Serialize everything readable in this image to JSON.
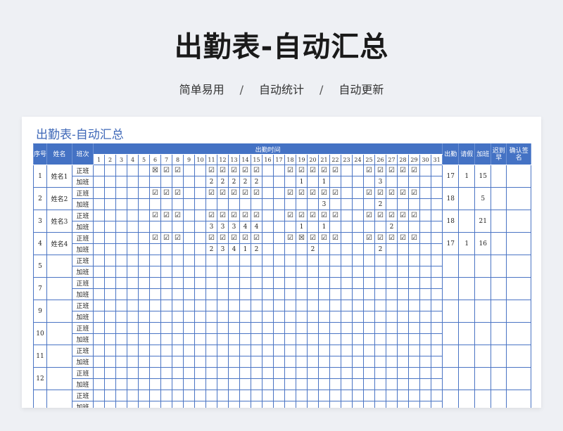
{
  "header": {
    "title": "出勤表-自动汇总",
    "tags": [
      "简单易用",
      "自动统计",
      "自动更新"
    ],
    "separator": "/"
  },
  "sheet": {
    "title": "出勤表-自动汇总",
    "columns": {
      "index": "序号",
      "name": "姓名",
      "shift": "班次",
      "attendance_time": "出勤时间",
      "attend": "出勤",
      "leave": "请假",
      "overtime": "加班",
      "late": "迟到早",
      "sign": "确认签名"
    },
    "days": [
      "1",
      "2",
      "3",
      "4",
      "5",
      "6",
      "7",
      "8",
      "9",
      "10",
      "11",
      "12",
      "13",
      "14",
      "15",
      "16",
      "17",
      "18",
      "19",
      "20",
      "21",
      "22",
      "23",
      "24",
      "25",
      "26",
      "27",
      "28",
      "29",
      "30",
      "31"
    ],
    "symbols": {
      "ok": "☑",
      "absent": "☒"
    },
    "rows": [
      {
        "index": "1",
        "name": "姓名1",
        "regular_label": "正班",
        "overtime_label": "加班",
        "regular": {
          "6": "absent",
          "7": "ok",
          "8": "ok",
          "11": "ok",
          "12": "ok",
          "13": "ok",
          "14": "ok",
          "15": "ok",
          "18": "ok",
          "19": "ok",
          "20": "ok",
          "21": "ok",
          "22": "ok",
          "25": "ok",
          "26": "ok",
          "27": "ok",
          "28": "ok",
          "29": "ok"
        },
        "overtime": {
          "11": "2",
          "12": "2",
          "13": "2",
          "14": "2",
          "15": "2",
          "19": "1",
          "21": "1",
          "26": "3"
        },
        "attend": "17",
        "leave": "1",
        "overtime_total": "15",
        "late": ""
      },
      {
        "index": "2",
        "name": "姓名2",
        "regular_label": "正班",
        "overtime_label": "加班",
        "regular": {
          "6": "ok",
          "7": "ok",
          "8": "ok",
          "11": "ok",
          "12": "ok",
          "13": "ok",
          "14": "ok",
          "15": "ok",
          "18": "ok",
          "19": "ok",
          "20": "ok",
          "21": "ok",
          "22": "ok",
          "25": "ok",
          "26": "ok",
          "27": "ok",
          "28": "ok",
          "29": "ok"
        },
        "overtime": {
          "21": "3",
          "26": "2"
        },
        "attend": "18",
        "leave": "",
        "overtime_total": "5",
        "late": ""
      },
      {
        "index": "3",
        "name": "姓名3",
        "regular_label": "正班",
        "overtime_label": "加班",
        "regular": {
          "6": "ok",
          "7": "ok",
          "8": "ok",
          "11": "ok",
          "12": "ok",
          "13": "ok",
          "14": "ok",
          "15": "ok",
          "18": "ok",
          "19": "ok",
          "20": "ok",
          "21": "ok",
          "22": "ok",
          "25": "ok",
          "26": "ok",
          "27": "ok",
          "28": "ok",
          "29": "ok"
        },
        "overtime": {
          "11": "3",
          "12": "3",
          "13": "3",
          "14": "4",
          "15": "4",
          "19": "1",
          "21": "1",
          "27": "2"
        },
        "attend": "18",
        "leave": "",
        "overtime_total": "21",
        "late": ""
      },
      {
        "index": "4",
        "name": "姓名4",
        "regular_label": "正班",
        "overtime_label": "加班",
        "regular": {
          "6": "ok",
          "7": "ok",
          "8": "ok",
          "11": "ok",
          "12": "ok",
          "13": "ok",
          "14": "ok",
          "15": "ok",
          "18": "ok",
          "19": "absent",
          "20": "ok",
          "21": "ok",
          "22": "ok",
          "25": "ok",
          "26": "ok",
          "27": "ok",
          "28": "ok",
          "29": "ok"
        },
        "overtime": {
          "11": "2",
          "12": "3",
          "13": "4",
          "14": "1",
          "15": "2",
          "20": "2",
          "26": "2"
        },
        "attend": "17",
        "leave": "1",
        "overtime_total": "16",
        "late": ""
      },
      {
        "index": "5",
        "name": "",
        "regular_label": "正班",
        "overtime_label": "加班",
        "regular": {},
        "overtime": {},
        "attend": "",
        "leave": "",
        "overtime_total": "",
        "late": ""
      },
      {
        "index": "7",
        "name": "",
        "regular_label": "正班",
        "overtime_label": "加班",
        "regular": {},
        "overtime": {},
        "attend": "",
        "leave": "",
        "overtime_total": "",
        "late": ""
      },
      {
        "index": "9",
        "name": "",
        "regular_label": "正班",
        "overtime_label": "加班",
        "regular": {},
        "overtime": {},
        "attend": "",
        "leave": "",
        "overtime_total": "",
        "late": ""
      },
      {
        "index": "10",
        "name": "",
        "regular_label": "正班",
        "overtime_label": "加班",
        "regular": {},
        "overtime": {},
        "attend": "",
        "leave": "",
        "overtime_total": "",
        "late": ""
      },
      {
        "index": "11",
        "name": "",
        "regular_label": "正班",
        "overtime_label": "加班",
        "regular": {},
        "overtime": {},
        "attend": "",
        "leave": "",
        "overtime_total": "",
        "late": ""
      },
      {
        "index": "12",
        "name": "",
        "regular_label": "正班",
        "overtime_label": "加班",
        "regular": {},
        "overtime": {},
        "attend": "",
        "leave": "",
        "overtime_total": "",
        "late": ""
      },
      {
        "index": "",
        "name": "",
        "regular_label": "正班",
        "overtime_label": "加班",
        "regular": {},
        "overtime": {},
        "attend": "",
        "leave": "",
        "overtime_total": "",
        "late": ""
      }
    ]
  }
}
